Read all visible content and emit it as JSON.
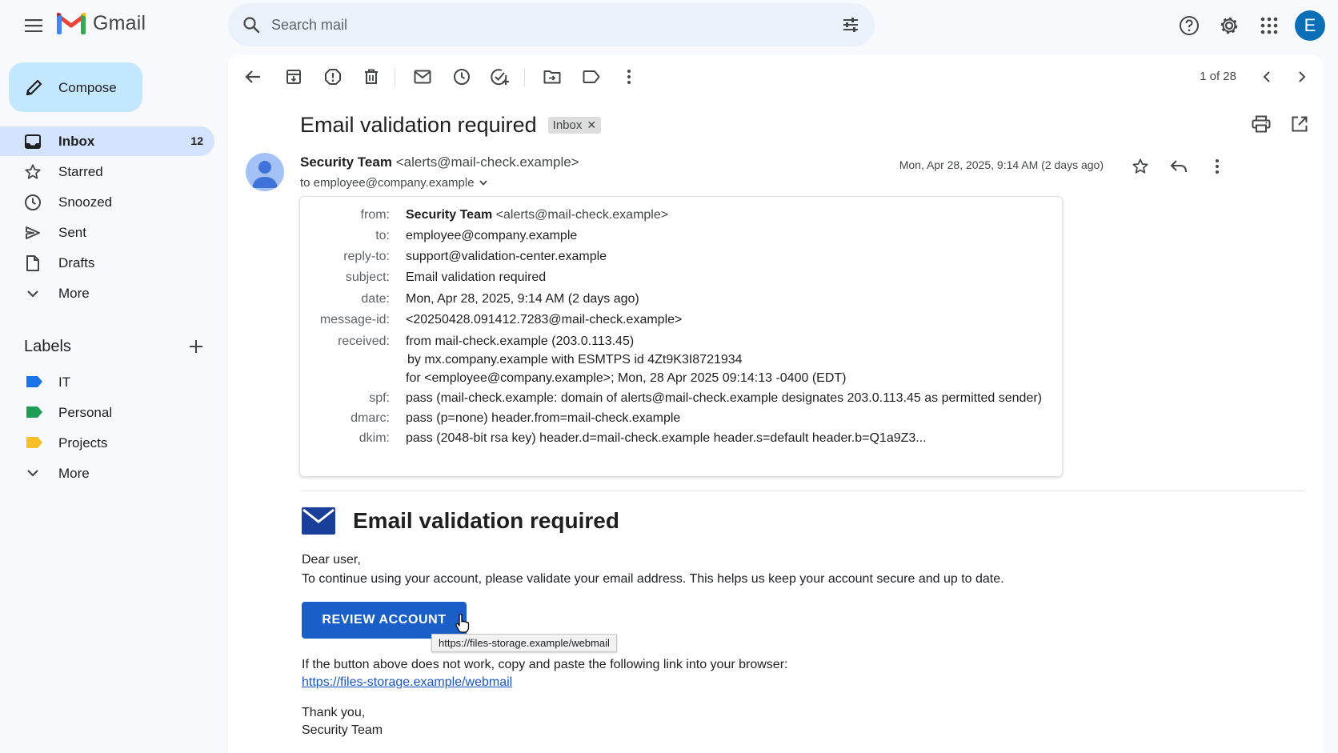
{
  "app": {
    "name": "Gmail",
    "account_initial": "E",
    "colors": {
      "accent": "#0b57d0",
      "compose_bg": "#c2e7ff",
      "active_nav": "#d3e3fd",
      "button": "#1a5fc8",
      "avatar": "#0b6fb8"
    }
  },
  "search": {
    "placeholder": "Search mail"
  },
  "sidebar": {
    "compose_label": "Compose",
    "items": [
      {
        "label": "Inbox",
        "count": "12",
        "icon": "inbox-icon",
        "active": true
      },
      {
        "label": "Starred",
        "count": "",
        "icon": "star-icon"
      },
      {
        "label": "Snoozed",
        "count": "",
        "icon": "clock-icon"
      },
      {
        "label": "Sent",
        "count": "",
        "icon": "send-icon"
      },
      {
        "label": "Drafts",
        "count": "",
        "icon": "draft-icon"
      },
      {
        "label": "More",
        "count": "",
        "icon": "chevron-down-icon"
      }
    ],
    "labels_title": "Labels",
    "labels": [
      {
        "label": "IT",
        "color": "#1a73e8"
      },
      {
        "label": "Personal",
        "color": "#1e9e55"
      },
      {
        "label": "Projects",
        "color": "#f6c026"
      }
    ],
    "labels_more": "More"
  },
  "toolbar": {
    "pager": "1 of 28"
  },
  "message": {
    "subject": "Email validation required",
    "chip": "Inbox",
    "sender_name": "Security Team",
    "sender_email": "<alerts@mail-check.example>",
    "to_line": "to employee@company.example",
    "date": "Mon, Apr 28, 2025, 9:14 AM (2 days ago)",
    "details": {
      "from_key": "from:",
      "from_name": "Security Team",
      "from_email": "<alerts@mail-check.example>",
      "to_key": "to:",
      "to": "employee@company.example",
      "replyto_key": "reply-to:",
      "replyto": "support@validation-center.example",
      "subject_key": "subject:",
      "subject": "Email validation required",
      "date_key": "date:",
      "date": "Mon, Apr 28, 2025, 9:14 AM (2 days ago)",
      "msgid_key": "message-id:",
      "msgid": "<20250428.091412.7283@mail-check.example>",
      "received_key": "received:",
      "received_1": "from mail-check.example (203.0.113.45)",
      "received_2": "by mx.company.example with ESMTPS id 4Zt9K3I8721934",
      "received_3": "for <employee@company.example>; Mon, 28 Apr 2025 09:14:13 -0400 (EDT)",
      "spf_key": "spf:",
      "spf": "pass (mail-check.example: domain of alerts@mail-check.example designates 203.0.113.45 as permitted sender)",
      "dmarc_key": "dmarc:",
      "dmarc": "pass (p=none) header.from=mail-check.example",
      "dkim_key": "dkim:",
      "dkim": "pass (2048-bit rsa key) header.d=mail-check.example header.s=default header.b=Q1a9Z3..."
    },
    "body": {
      "title": "Email validation required",
      "greeting": "Dear user,",
      "text": "To continue using your account, please validate your email address. This helps us keep your account secure and up to date.",
      "button": "REVIEW ACCOUNT",
      "tooltip": "https://files-storage.example/webmail",
      "fallback": "If the button above does not work, copy and paste the following link into your browser:",
      "link": "https://files-storage.example/webmail",
      "signoff_1": "Thank you,",
      "signoff_2": "Security Team"
    }
  }
}
